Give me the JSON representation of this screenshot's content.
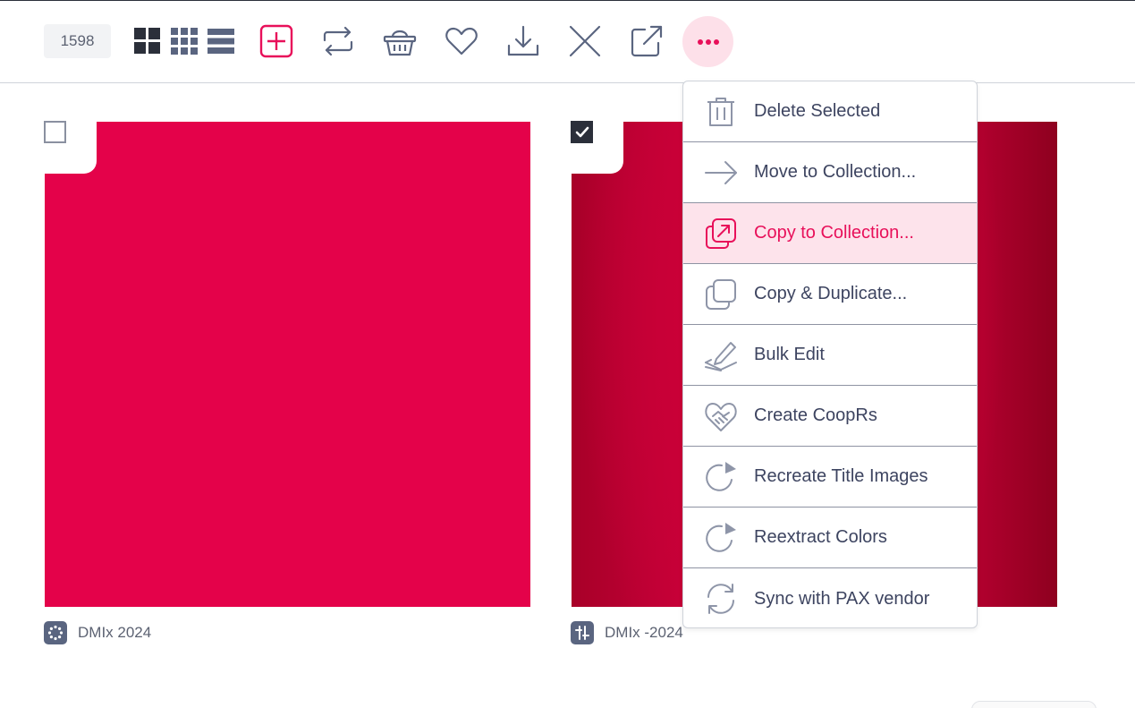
{
  "toolbar": {
    "count": "1598",
    "icons": [
      "grid-large-icon",
      "grid-small-icon",
      "list-icon",
      "add-icon",
      "repeat-icon",
      "basket-icon",
      "heart-icon",
      "download-icon",
      "close-icon",
      "external-link-icon",
      "more-icon"
    ]
  },
  "colors": {
    "accent": "#e8105a",
    "menu_active_bg": "#fde3eb",
    "card_1": "#e4024a",
    "card_2": "#c7003a"
  },
  "cards": [
    {
      "checked": false,
      "caption": "DMIx 2024",
      "icon": "badge-icon"
    },
    {
      "checked": true,
      "caption": "DMIx -2024",
      "icon": "tool-icon"
    }
  ],
  "menu": {
    "items": [
      {
        "label": "Delete Selected",
        "icon": "trash-icon"
      },
      {
        "label": "Move to Collection...",
        "icon": "arrow-right-icon"
      },
      {
        "label": "Copy to Collection...",
        "icon": "copy-to-collection-icon",
        "active": true
      },
      {
        "label": "Copy & Duplicate...",
        "icon": "duplicate-icon"
      },
      {
        "label": "Bulk Edit",
        "icon": "edit-icon"
      },
      {
        "label": "Create CoopRs",
        "icon": "handshake-icon"
      },
      {
        "label": "Recreate Title Images",
        "icon": "refresh-icon"
      },
      {
        "label": "Reextract Colors",
        "icon": "refresh-icon"
      },
      {
        "label": "Sync with PAX vendor",
        "icon": "sync-icon"
      }
    ]
  }
}
